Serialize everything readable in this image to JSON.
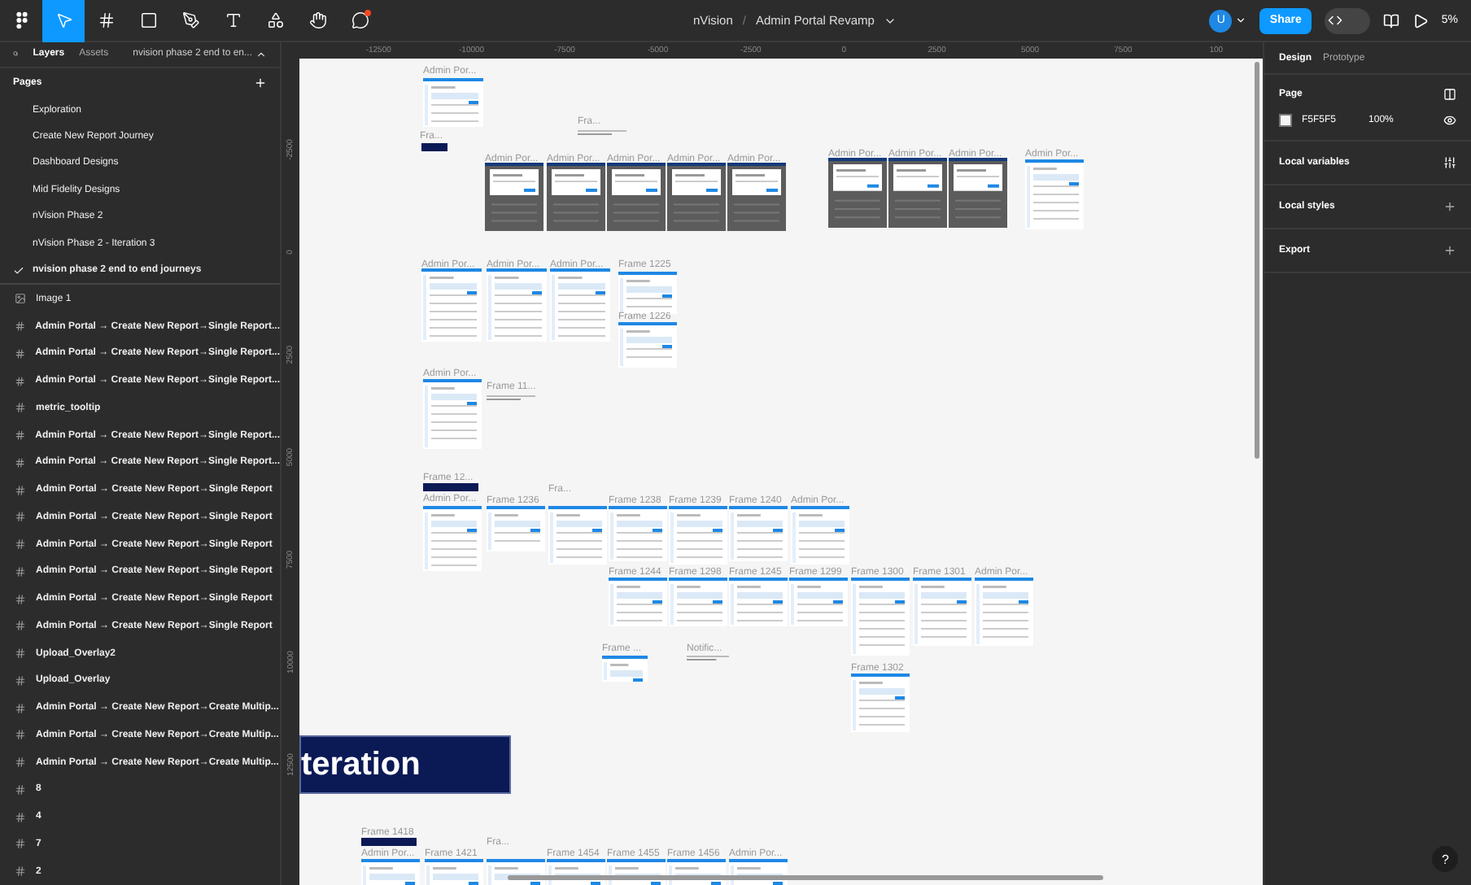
{
  "toolbar": {
    "tools": [
      {
        "kind": "menu",
        "selected": false
      },
      {
        "kind": "move",
        "selected": true
      },
      {
        "kind": "frame",
        "selected": false
      },
      {
        "kind": "shape",
        "selected": false
      },
      {
        "kind": "pen",
        "selected": false
      },
      {
        "kind": "text",
        "selected": false
      },
      {
        "kind": "actions",
        "selected": false
      },
      {
        "kind": "hand",
        "selected": false
      },
      {
        "kind": "comment",
        "selected": false,
        "notification": true
      }
    ],
    "project": "nVision",
    "separator": "/",
    "file": "Admin Portal Revamp",
    "user_initial": "U",
    "dev_mode": false,
    "share": "Share",
    "zoom": "5%"
  },
  "left_panel": {
    "tabs": [
      {
        "label": "Layers",
        "selected": true
      },
      {
        "label": "Assets",
        "selected": false
      }
    ],
    "page_picker": "nvision phase 2 end to en...",
    "pages_heading": "Pages",
    "pages": [
      {
        "label": "Exploration",
        "selected": false
      },
      {
        "label": "Create New Report Journey",
        "selected": false
      },
      {
        "label": "Dashboard Designs",
        "selected": false
      },
      {
        "label": "Mid Fidelity Designs",
        "selected": false
      },
      {
        "label": "nVision Phase 2",
        "selected": false
      },
      {
        "label": "nVision Phase 2 - Iteration 3",
        "selected": false
      },
      {
        "label": "nvision phase 2 end to end journeys",
        "selected": true
      }
    ],
    "layers": [
      {
        "kind": "image",
        "label": "Image 1"
      },
      {
        "kind": "frame",
        "label": "Admin Portal → Create New Report→Single Report..."
      },
      {
        "kind": "frame",
        "label": "Admin Portal → Create New Report→Single Report..."
      },
      {
        "kind": "frame",
        "label": "Admin Portal → Create New Report→Single Report..."
      },
      {
        "kind": "frame",
        "label": "metric_tooltip"
      },
      {
        "kind": "frame",
        "label": "Admin Portal → Create New Report→Single Report..."
      },
      {
        "kind": "frame",
        "label": "Admin Portal → Create New Report→Single Report..."
      },
      {
        "kind": "frame",
        "label": "Admin Portal → Create New Report→Single Report"
      },
      {
        "kind": "frame",
        "label": "Admin Portal → Create New Report→Single Report"
      },
      {
        "kind": "frame",
        "label": "Admin Portal → Create New Report→Single Report"
      },
      {
        "kind": "frame",
        "label": "Admin Portal → Create New Report→Single Report"
      },
      {
        "kind": "frame",
        "label": "Admin Portal → Create New Report→Single Report"
      },
      {
        "kind": "frame",
        "label": "Admin Portal → Create New Report→Single Report"
      },
      {
        "kind": "frame",
        "label": "Upload_Overlay2"
      },
      {
        "kind": "frame",
        "label": "Upload_Overlay"
      },
      {
        "kind": "frame",
        "label": "Admin Portal → Create New Report→Create Multip..."
      },
      {
        "kind": "frame",
        "label": "Admin Portal → Create New Report→Create Multip..."
      },
      {
        "kind": "frame",
        "label": "Admin Portal → Create New Report→Create Multip..."
      },
      {
        "kind": "frame",
        "label": "8"
      },
      {
        "kind": "frame",
        "label": "4"
      },
      {
        "kind": "frame",
        "label": "7"
      },
      {
        "kind": "frame",
        "label": "2"
      }
    ]
  },
  "rulers": {
    "horizontal": [
      "-12500",
      "-10000",
      "-7500",
      "-5000",
      "-2500",
      "0",
      "2500",
      "5000",
      "7500",
      "100"
    ],
    "vertical": [
      "-2500",
      "0",
      "2500",
      "5000",
      "7500",
      "10000",
      "12500"
    ]
  },
  "canvas": {
    "frames": [
      {
        "label": "Admin Por...",
        "kind": "light"
      },
      {
        "label": "Fra...",
        "kind": "chip"
      },
      {
        "label": "Fra...",
        "kind": "note"
      },
      {
        "label": "Admin Por...",
        "kind": "dark"
      },
      {
        "label": "Admin Por...",
        "kind": "dark"
      },
      {
        "label": "Admin Por...",
        "kind": "dark"
      },
      {
        "label": "Admin Por...",
        "kind": "dark"
      },
      {
        "label": "Admin Por...",
        "kind": "dark"
      },
      {
        "label": "Admin Por...",
        "kind": "dark"
      },
      {
        "label": "Admin Por...",
        "kind": "dark"
      },
      {
        "label": "Admin Por...",
        "kind": "dark"
      },
      {
        "label": "Admin Por...",
        "kind": "light"
      },
      {
        "label": "Admin Por...",
        "kind": "light"
      },
      {
        "label": "Admin Por...",
        "kind": "light"
      },
      {
        "label": "Admin Por...",
        "kind": "light"
      },
      {
        "label": "Frame 1225",
        "kind": "light"
      },
      {
        "label": "Frame 1226",
        "kind": "light"
      },
      {
        "label": "Admin Por...",
        "kind": "light"
      },
      {
        "label": "Frame 11...",
        "kind": "note"
      },
      {
        "label": "Frame 12...",
        "kind": "chip"
      },
      {
        "label": "Admin Por...",
        "kind": "light"
      },
      {
        "label": "Frame 1236",
        "kind": "light"
      },
      {
        "label": "Fra...",
        "kind": "light"
      },
      {
        "label": "Frame 1238",
        "kind": "light"
      },
      {
        "label": "Frame 1239",
        "kind": "light"
      },
      {
        "label": "Frame 1240",
        "kind": "light"
      },
      {
        "label": "Admin Por...",
        "kind": "light"
      },
      {
        "label": "Frame 1244",
        "kind": "light"
      },
      {
        "label": "Frame 1298",
        "kind": "light"
      },
      {
        "label": "Frame 1245",
        "kind": "light"
      },
      {
        "label": "Frame 1299",
        "kind": "light"
      },
      {
        "label": "Frame 1300",
        "kind": "light"
      },
      {
        "label": "Frame 1301",
        "kind": "light"
      },
      {
        "label": "Admin Por...",
        "kind": "light"
      },
      {
        "label": "Frame ...",
        "kind": "light"
      },
      {
        "label": "Notific...",
        "kind": "note"
      },
      {
        "label": "Frame 1302",
        "kind": "light"
      },
      {
        "label": "Frame 1418",
        "kind": "chip"
      },
      {
        "label": "Admin Por...",
        "kind": "light"
      },
      {
        "label": "Frame 1421",
        "kind": "light"
      },
      {
        "label": "Fra...",
        "kind": "light"
      },
      {
        "label": "Frame 1454",
        "kind": "light"
      },
      {
        "label": "Frame 1455",
        "kind": "light"
      },
      {
        "label": "Frame 1456",
        "kind": "light"
      },
      {
        "label": "Admin Por...",
        "kind": "light"
      }
    ],
    "banner": "teration"
  },
  "right_panel": {
    "tabs": [
      {
        "label": "Design",
        "selected": true
      },
      {
        "label": "Prototype",
        "selected": false
      }
    ],
    "page": {
      "heading": "Page",
      "color": "#f5f5f5",
      "hex": "F5F5F5",
      "opacity": "100%"
    },
    "sections": [
      {
        "label": "Local variables",
        "kind": "variables"
      },
      {
        "label": "Local styles",
        "kind": "add"
      },
      {
        "label": "Export",
        "kind": "add"
      }
    ],
    "help": "?"
  }
}
